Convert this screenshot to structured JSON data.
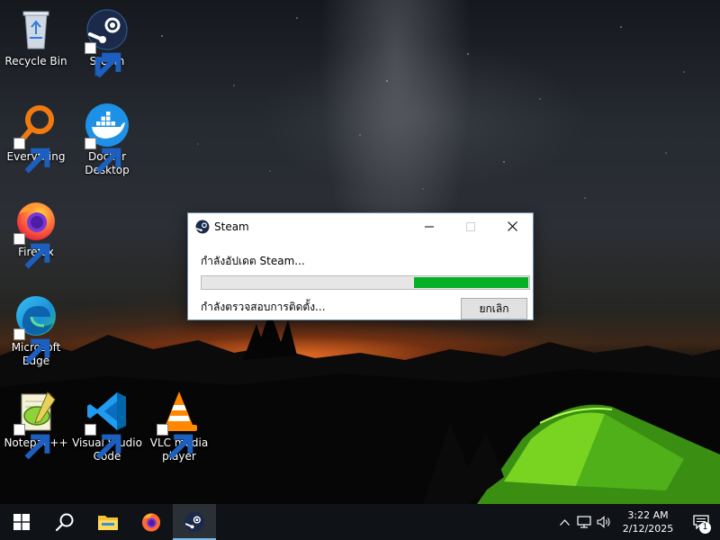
{
  "desktop": {
    "icons": [
      {
        "label": "Recycle Bin",
        "icon": "recycle-bin-icon"
      },
      {
        "label": "Steam",
        "icon": "steam-icon"
      },
      {
        "label": "Everything",
        "icon": "everything-search-icon"
      },
      {
        "label": "Docker Desktop",
        "icon": "docker-icon"
      },
      {
        "label": "Firefox",
        "icon": "firefox-icon"
      },
      {
        "label": "Microsoft Edge",
        "icon": "edge-icon"
      },
      {
        "label": "Notepad++",
        "icon": "notepad-plus-plus-icon"
      },
      {
        "label": "Visual Studio Code",
        "icon": "vscode-icon"
      },
      {
        "label": "VLC media player",
        "icon": "vlc-icon"
      }
    ]
  },
  "dialog": {
    "title": "Steam",
    "message": "กำลังอัปเดต Steam...",
    "status": "กำลังตรวจสอบการติดตั้ง...",
    "cancel_label": "ยกเลิก",
    "progress_fraction": 0.35,
    "progress_color": "#06b025"
  },
  "taskbar": {
    "items": [
      "windows-start-icon",
      "search-icon",
      "file-explorer-icon",
      "firefox-icon",
      "steam-icon"
    ],
    "active_item": "steam-icon",
    "clock": {
      "time": "3:22 AM",
      "date": "2/12/2025"
    },
    "notification_count": "1",
    "accent_color": "#76b9ed"
  }
}
